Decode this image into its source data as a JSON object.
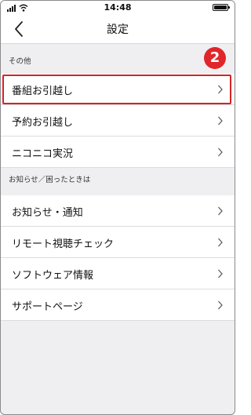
{
  "status_bar": {
    "time": "14:48"
  },
  "nav": {
    "title": "設定"
  },
  "step_badge": "2",
  "sections": [
    {
      "header": "その他",
      "items": [
        {
          "label": "番組お引越し",
          "highlighted": true
        },
        {
          "label": "予約お引越し"
        },
        {
          "label": "ニコニコ実況"
        }
      ]
    },
    {
      "header": "お知らせ／困ったときは",
      "items": [
        {
          "label": "お知らせ・通知"
        },
        {
          "label": "リモート視聴チェック"
        },
        {
          "label": "ソフトウェア情報"
        },
        {
          "label": "サポートページ"
        }
      ]
    }
  ],
  "colors": {
    "highlight": "#d62328",
    "badge": "#e0262a",
    "background": "#efeff1"
  }
}
